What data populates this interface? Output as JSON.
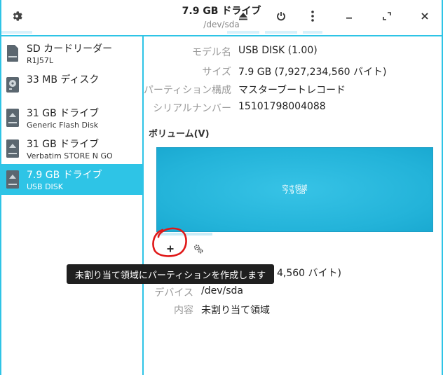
{
  "window": {
    "title": "7.9 GB ドライブ",
    "subtitle": "/dev/sda",
    "accent_color": "#2ec4e6"
  },
  "header": {
    "settings_icon": "gear-icon",
    "eject_icon": "eject-icon",
    "power_icon": "power-icon",
    "menu_icon": "vertical-ellipsis-icon",
    "minimize_icon": "minimize-icon",
    "maximize_icon": "maximize-icon",
    "close_icon": "close-icon"
  },
  "sidebar": {
    "items": [
      {
        "name": "SD カードリーダー",
        "sub": "R1J57L",
        "icon": "sd-card-icon"
      },
      {
        "name": "33 MB ディスク",
        "sub": "",
        "icon": "hard-disk-icon"
      },
      {
        "name": "31 GB ドライブ",
        "sub": "Generic Flash Disk",
        "icon": "removable-drive-icon"
      },
      {
        "name": "31 GB ドライブ",
        "sub": "Verbatim STORE N GO",
        "icon": "removable-drive-icon"
      },
      {
        "name": "7.9 GB ドライブ",
        "sub": "USB DISK",
        "icon": "removable-drive-icon",
        "selected": true
      }
    ]
  },
  "properties": {
    "model_label": "モデル名",
    "model_value": "USB DISK (1.00)",
    "size_label": "サイズ",
    "size_value": "7.9 GB (7,927,234,560 バイト)",
    "partitioning_label": "パーティション構成",
    "partitioning_value": "マスターブートレコード",
    "serial_label": "シリアルナンバー",
    "serial_value": "15101798004088"
  },
  "volumes": {
    "section_title": "ボリューム(V)",
    "block_line1": "空き領域",
    "block_line2": "7.9 GB",
    "add_icon": "plus-icon",
    "options_icon": "gears-icon"
  },
  "tooltip": {
    "text": "未割り当て領域にパーティションを作成します"
  },
  "volume_details": {
    "size_value_partial": "4,560 バイト)",
    "device_label": "デバイス",
    "device_value": "/dev/sda",
    "contents_label": "内容",
    "contents_value": "未割り当て領域"
  },
  "annotation": {
    "circle_color": "#e01818"
  }
}
